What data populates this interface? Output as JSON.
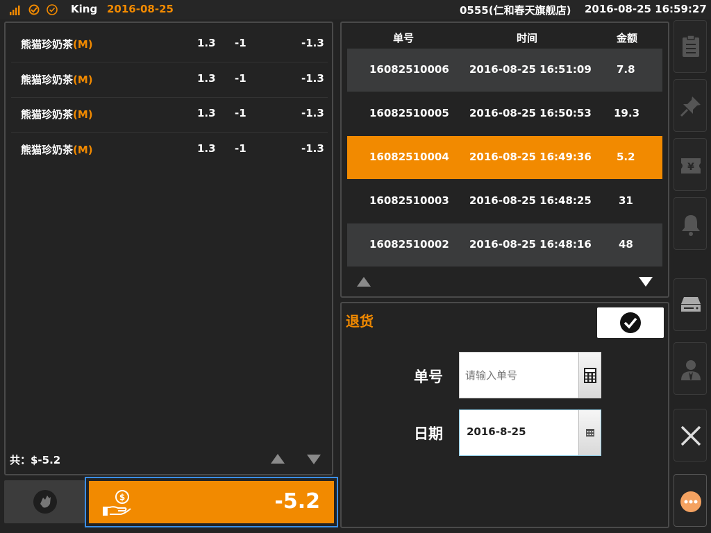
{
  "topbar": {
    "user": "King",
    "date": "2016-08-25",
    "store": "0555(仁和春天旗舰店)",
    "datetime": "2016-08-25 16:59:27",
    "icons": [
      "signal-icon",
      "sync-icon",
      "check-circle-icon"
    ]
  },
  "items": [
    {
      "name": "熊猫珍奶茶",
      "size": "(M)",
      "price": "1.3",
      "qty": "-1",
      "total": "-1.3"
    },
    {
      "name": "熊猫珍奶茶",
      "size": "(M)",
      "price": "1.3",
      "qty": "-1",
      "total": "-1.3"
    },
    {
      "name": "熊猫珍奶茶",
      "size": "(M)",
      "price": "1.3",
      "qty": "-1",
      "total": "-1.3"
    },
    {
      "name": "熊猫珍奶茶",
      "size": "(M)",
      "price": "1.3",
      "qty": "-1",
      "total": "-1.3"
    }
  ],
  "summary": {
    "total_label": "共：$-5.2"
  },
  "pay": {
    "amount": "-5.2"
  },
  "orders": {
    "headers": [
      "单号",
      "时间",
      "金额"
    ],
    "rows": [
      {
        "id": "16082510006",
        "time": "2016-08-25 16:51:09",
        "amount": "7.8"
      },
      {
        "id": "16082510005",
        "time": "2016-08-25 16:50:53",
        "amount": "19.3"
      },
      {
        "id": "16082510004",
        "time": "2016-08-25 16:49:36",
        "amount": "5.2"
      },
      {
        "id": "16082510003",
        "time": "2016-08-25 16:48:25",
        "amount": "31"
      },
      {
        "id": "16082510002",
        "time": "2016-08-25 16:48:16",
        "amount": "48"
      }
    ]
  },
  "return_form": {
    "title": "退货",
    "order_label": "单号",
    "order_placeholder": "请输入单号",
    "date_label": "日期",
    "date_value": "2016-8-25"
  },
  "sidebar": [
    "clipboard-icon",
    "pin-icon",
    "ticket-yen-icon",
    "bell-icon",
    "cash-drawer-icon",
    "user-icon",
    "close-icon",
    "more-icon"
  ],
  "colors": {
    "accent": "#f28a00",
    "background": "#232323",
    "row_gray": "#3a3b3c",
    "focus_border": "#3a8ee6"
  }
}
